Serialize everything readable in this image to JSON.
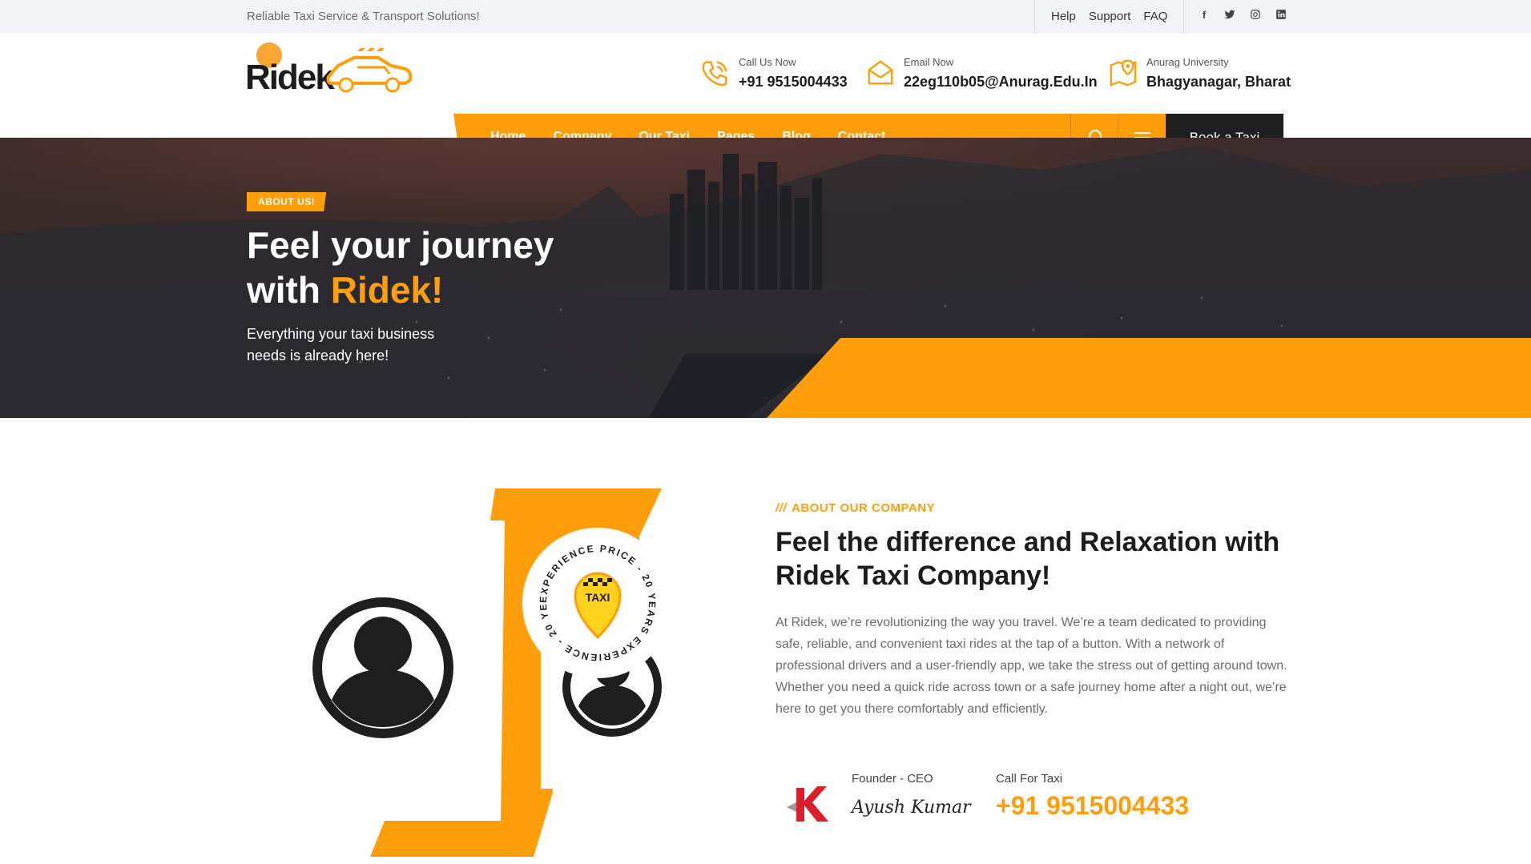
{
  "topbar": {
    "tagline": "Reliable Taxi Service & Transport Solutions!",
    "links": [
      "Help",
      "Support",
      "FAQ"
    ],
    "social": [
      "facebook-icon",
      "twitter-icon",
      "instagram-icon",
      "linkedin-icon"
    ]
  },
  "logo": {
    "text": "Ridek"
  },
  "contacts": [
    {
      "label": "Call Us Now",
      "value": "+91 9515004433",
      "icon": "phone-icon"
    },
    {
      "label": "Email Now",
      "value": "22eg110b05@Anurag.Edu.In",
      "icon": "mail-icon"
    },
    {
      "label": "Anurag University",
      "value": "Bhagyanagar, Bharat",
      "icon": "map-icon"
    }
  ],
  "nav": {
    "items": [
      "Home",
      "Company",
      "Our Taxi",
      "Pages",
      "Blog",
      "Contact"
    ],
    "active": "Company",
    "book_label": "Book a Taxi"
  },
  "hero": {
    "badge": "ABOUT US!",
    "title_line1": "Feel your journey",
    "title_line2_prefix": "with ",
    "title_accent": "Ridek!",
    "subtitle": "Everything your taxi business needs is already here!"
  },
  "about": {
    "kicker_slashes": "///",
    "kicker": "ABOUT OUR COMPANY",
    "title": "Feel the difference and Relaxation with Ridek Taxi Company!",
    "text": "At Ridek, we’re revolutionizing the way you travel. We’re a team dedicated to providing safe, reliable, and convenient taxi rides at the tap of a button. With a network of professional drivers and a user-friendly app, we take the stress out of getting around town. Whether you need a quick ride across town or a safe journey home after a night out, we’re here to get you there comfortably and efficiently.",
    "badge_ring_text": "EXPERIENCE PRICE - 20 YEARS EXPERIENCE - 20 YEARS",
    "badge_center": "TAXI",
    "founder_role": "Founder - CEO",
    "founder_name": "Ayush Kumar",
    "call_label": "Call For Taxi",
    "call_number": "+91 9515004433"
  },
  "colors": {
    "accent": "#fe9e0b",
    "dark": "#1e1e1e"
  }
}
